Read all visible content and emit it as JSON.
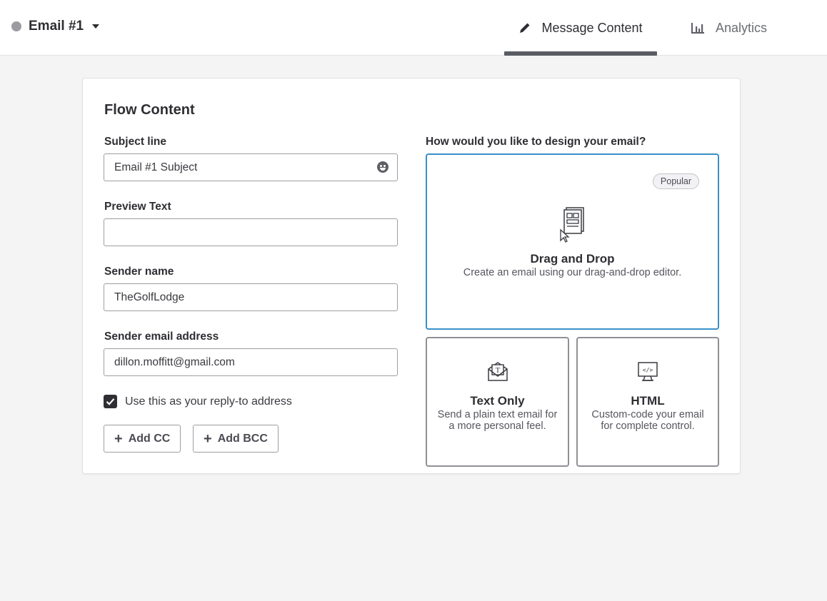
{
  "header": {
    "email_title": "Email #1",
    "tabs": [
      {
        "label": "Message Content",
        "icon": "pencil-icon",
        "active": true
      },
      {
        "label": "Analytics",
        "icon": "bar-chart-icon",
        "active": false
      }
    ]
  },
  "form": {
    "title": "Flow Content",
    "subject_label": "Subject line",
    "subject_value": "Email #1 Subject",
    "preview_label": "Preview Text",
    "preview_value": "",
    "sender_name_label": "Sender name",
    "sender_name_value": "TheGolfLodge",
    "sender_email_label": "Sender email address",
    "sender_email_value": "dillon.moffitt@gmail.com",
    "reply_to_label": "Use this as your reply-to address",
    "reply_to_checked": true,
    "add_cc_label": "Add CC",
    "add_bcc_label": "Add BCC"
  },
  "design": {
    "question": "How would you like to design your email?",
    "options": [
      {
        "title": "Drag and Drop",
        "desc": "Create an email using our drag-and-drop editor.",
        "badge": "Popular",
        "selected": true
      },
      {
        "title": "Text Only",
        "desc": "Send a plain text email for a more personal feel.",
        "selected": false
      },
      {
        "title": "HTML",
        "desc": "Custom-code your email for complete control.",
        "selected": false
      }
    ]
  },
  "colors": {
    "accent_selected": "#3a8fc9",
    "text_primary": "#2e2e33",
    "tab_indicator": "#5a5c63"
  }
}
